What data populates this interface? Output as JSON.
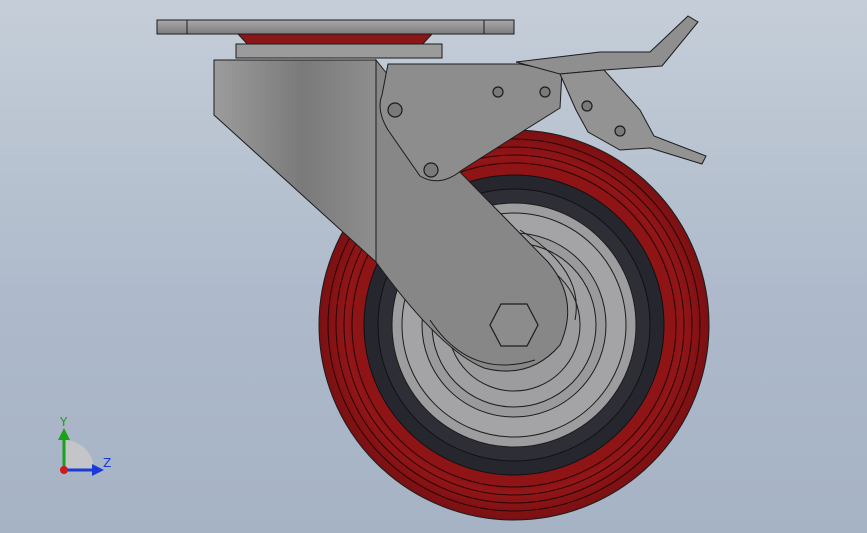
{
  "triad": {
    "y_label": "Y",
    "z_label": "Z",
    "y_color": "#1aa01a",
    "z_color": "#1a3ad8",
    "x_color": "#d01818"
  },
  "colors": {
    "tire": "#8a1214",
    "tire_dark": "#5f0a0c",
    "tire_light": "#a82224",
    "hub_dark": "#26262e",
    "rim": "#9a9a9c",
    "rim_light": "#b4b4b6",
    "fork": "#8a8a8a",
    "fork_shade": "#6c6c6c",
    "outline": "#1c1c1c"
  },
  "model": {
    "parts": [
      "top-plate",
      "swivel-bearing",
      "fork",
      "wheel",
      "axle-nut",
      "brake-lever"
    ]
  }
}
